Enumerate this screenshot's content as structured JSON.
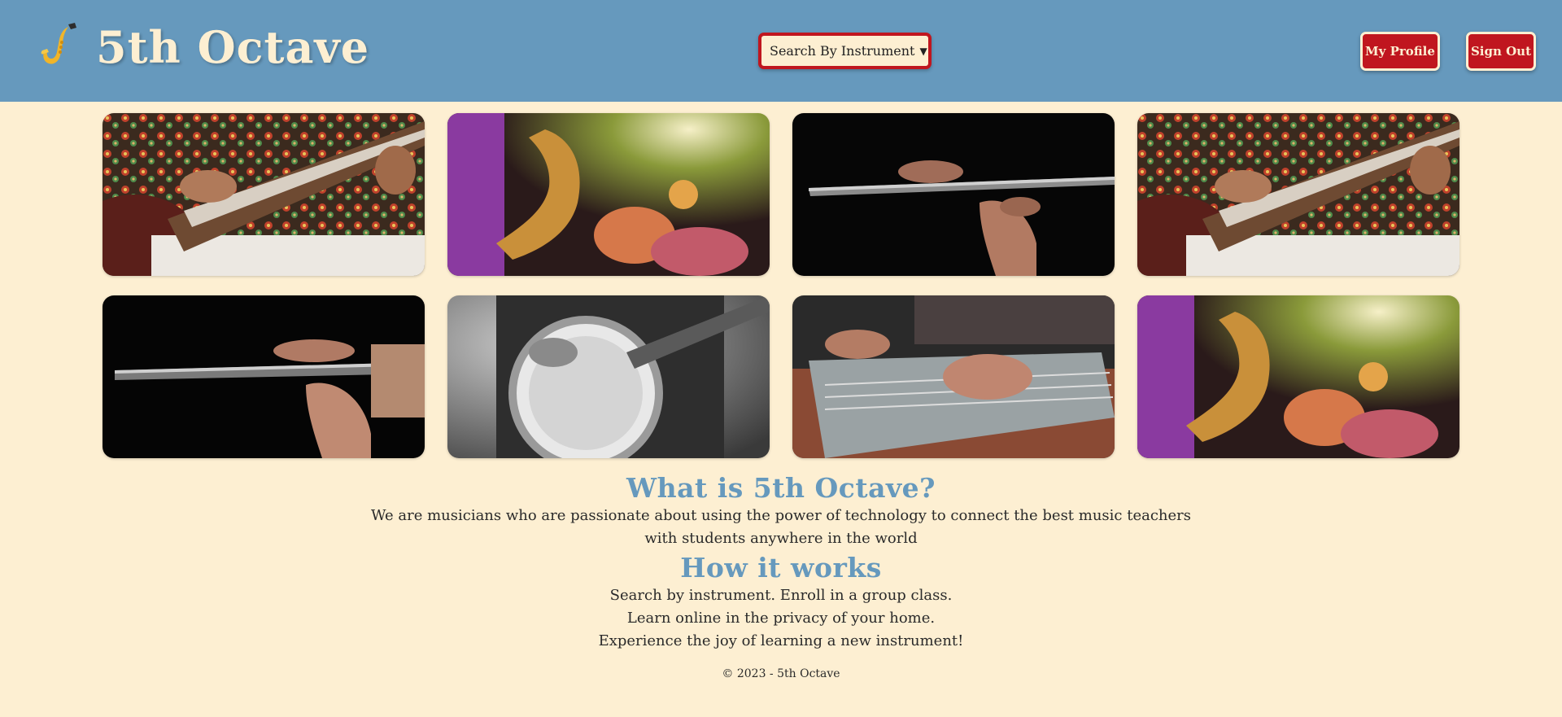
{
  "header": {
    "brand": "5th Octave",
    "logo_icon": "saxophone-icon",
    "search_select": {
      "selected": "Search By Instrument"
    },
    "buttons": {
      "profile": "My Profile",
      "signout": "Sign Out"
    }
  },
  "gallery": {
    "tiles": [
      {
        "instrument": "sitar"
      },
      {
        "instrument": "saxophone"
      },
      {
        "instrument": "flute"
      },
      {
        "instrument": "sitar"
      },
      {
        "instrument": "flute"
      },
      {
        "instrument": "banjo"
      },
      {
        "instrument": "pedal steel guitar"
      },
      {
        "instrument": "saxophone"
      }
    ]
  },
  "about": {
    "title": "What is 5th Octave?",
    "line1": "We are musicians who are passionate about using the power of technology to connect the best music teachers",
    "line2": "with students anywhere in the world"
  },
  "how": {
    "title": "How it works",
    "lines": [
      "Search by instrument. Enroll in a group class.",
      "Learn online in the privacy of your home.",
      "Experience the joy of learning a new instrument!"
    ]
  },
  "footer": {
    "text": "© 2023 - 5th Octave"
  },
  "colors": {
    "header_bg": "#6699bd",
    "page_bg": "#fdefd2",
    "accent_red": "#c0161f",
    "heading_blue": "#6699bd"
  }
}
